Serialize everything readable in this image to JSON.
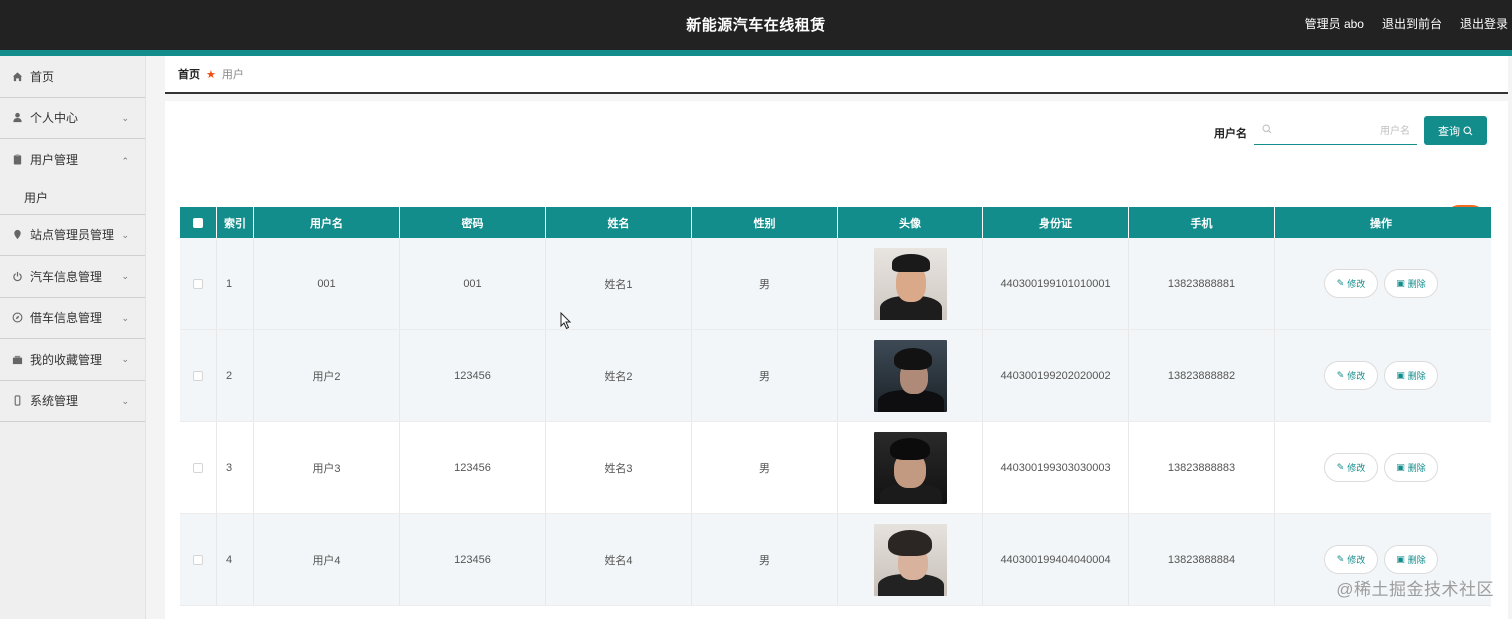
{
  "header": {
    "title": "新能源汽车在线租赁",
    "admin": "管理员 abo",
    "to_front": "退出到前台",
    "logout": "退出登录"
  },
  "sidebar": {
    "items": [
      {
        "label": "首页",
        "icon": "home-icon",
        "expandable": false
      },
      {
        "label": "个人中心",
        "icon": "user-icon",
        "expandable": true
      },
      {
        "label": "用户管理",
        "icon": "clipboard-icon",
        "expandable": true,
        "expanded": true,
        "children": [
          {
            "label": "用户"
          }
        ]
      },
      {
        "label": "站点管理员管理",
        "icon": "pin-icon",
        "expandable": true
      },
      {
        "label": "汽车信息管理",
        "icon": "power-icon",
        "expandable": true
      },
      {
        "label": "借车信息管理",
        "icon": "compass-icon",
        "expandable": true
      },
      {
        "label": "我的收藏管理",
        "icon": "box-icon",
        "expandable": true
      },
      {
        "label": "系统管理",
        "icon": "phone-icon",
        "expandable": true
      }
    ]
  },
  "breadcrumb": {
    "home": "首页",
    "current": "用户"
  },
  "search": {
    "label": "用户名",
    "placeholder": "用户名",
    "value": "",
    "button": "查询"
  },
  "table": {
    "columns": [
      "索引",
      "用户名",
      "密码",
      "姓名",
      "性别",
      "头像",
      "身份证",
      "手机",
      "操作"
    ],
    "rows": [
      {
        "index": "1",
        "username": "001",
        "password": "001",
        "name": "姓名1",
        "gender": "男",
        "idcard": "440300199101010001",
        "phone": "13823888881"
      },
      {
        "index": "2",
        "username": "用户2",
        "password": "123456",
        "name": "姓名2",
        "gender": "男",
        "idcard": "440300199202020002",
        "phone": "13823888882"
      },
      {
        "index": "3",
        "username": "用户3",
        "password": "123456",
        "name": "姓名3",
        "gender": "男",
        "idcard": "440300199303030003",
        "phone": "13823888883"
      },
      {
        "index": "4",
        "username": "用户4",
        "password": "123456",
        "name": "姓名4",
        "gender": "男",
        "idcard": "440300199404040004",
        "phone": "13823888884"
      }
    ],
    "edit_label": "修改",
    "delete_label": "删除"
  },
  "watermark": "@稀土掘金技术社区",
  "colors": {
    "accent": "#138c8c",
    "danger": "#f46a22",
    "topbar": "#222222"
  }
}
